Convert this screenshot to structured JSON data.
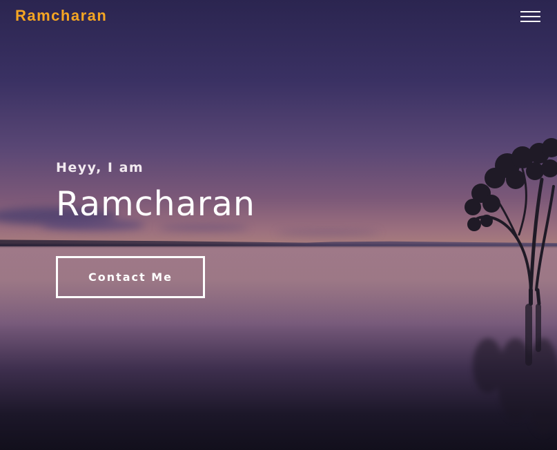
{
  "navbar": {
    "brand": "Ramcharan",
    "menu_icon": "hamburger-menu-icon"
  },
  "hero": {
    "greeting": "Heyy, I am",
    "name": "Ramcharan",
    "cta_label": "Contact Me"
  },
  "colors": {
    "brand": "#f5a623",
    "text": "#ffffff",
    "sky_top": "#2b2550",
    "sunset": "#a67b7d",
    "water_dark": "#120f1c"
  }
}
